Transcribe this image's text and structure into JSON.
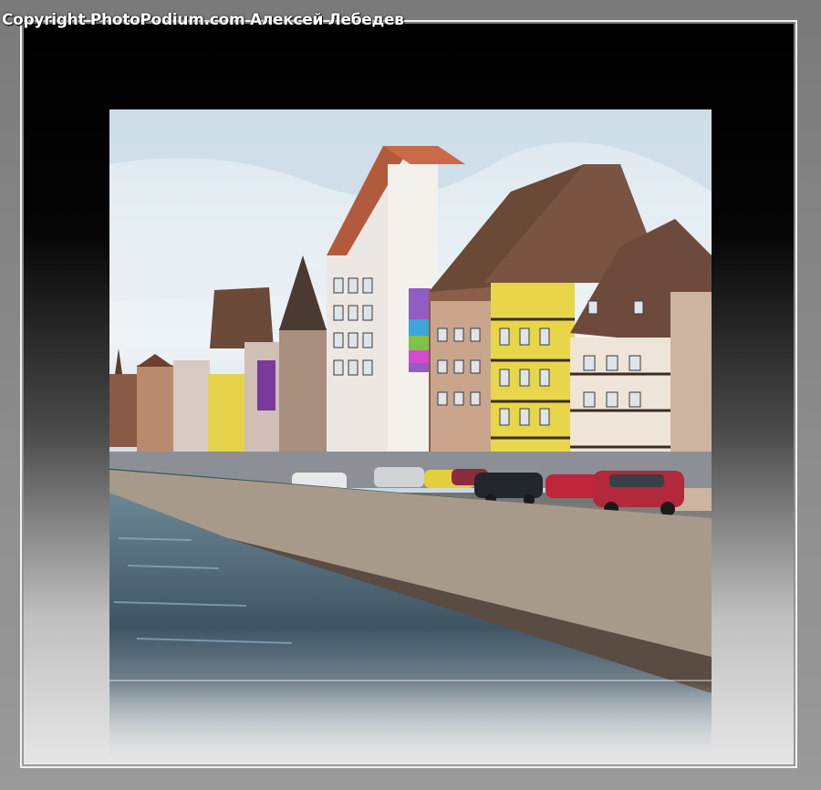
{
  "watermark": {
    "text": "Copyright PhotoPodium.com Алексей Лебедев"
  },
  "image": {
    "subject": "half-timbered-houses-along-canal-with-parked-cars-painted-effect"
  },
  "colors": {
    "frame": "#8e8e8e",
    "border": "#f2f2f2",
    "sky": "#dfe9f0",
    "water": "#5e7d8f"
  }
}
